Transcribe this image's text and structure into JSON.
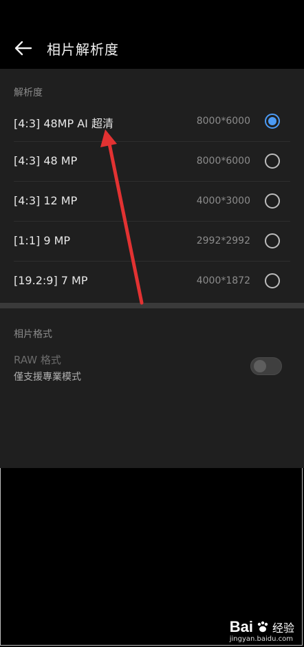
{
  "header": {
    "title": "相片解析度"
  },
  "resolution_section": {
    "header": "解析度",
    "options": [
      {
        "label": "[4:3] 48MP AI 超清",
        "value": "8000*6000",
        "selected": true
      },
      {
        "label": "[4:3] 48 MP",
        "value": "8000*6000",
        "selected": false
      },
      {
        "label": "[4:3] 12 MP",
        "value": "4000*3000",
        "selected": false
      },
      {
        "label": "[1:1] 9 MP",
        "value": "2992*2992",
        "selected": false
      },
      {
        "label": "[19.2:9] 7 MP",
        "value": "4000*1872",
        "selected": false
      }
    ]
  },
  "format_section": {
    "header": "相片格式",
    "raw_label": "RAW 格式",
    "raw_sub": "僅支援專業模式",
    "raw_enabled": false
  },
  "colors": {
    "accent": "#4c9bf5",
    "annotation_arrow": "#e23232"
  },
  "watermark": {
    "logo": "Bai",
    "text": "经验",
    "url": "jingyan.baidu.com"
  }
}
